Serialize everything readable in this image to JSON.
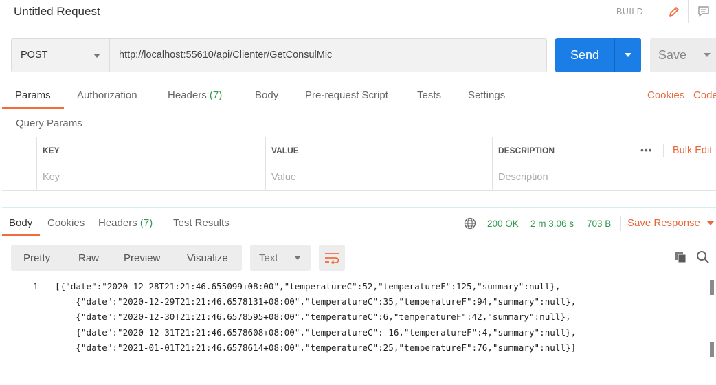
{
  "header": {
    "title": "Untitled Request",
    "build_label": "BUILD"
  },
  "request": {
    "method": "POST",
    "url": "http://localhost:55610/api/Clienter/GetConsulMic",
    "send_label": "Send",
    "save_label": "Save"
  },
  "req_tabs": {
    "params": "Params",
    "authorization": "Authorization",
    "headers": "Headers",
    "headers_count": "(7)",
    "body": "Body",
    "pre_request": "Pre-request Script",
    "tests": "Tests",
    "settings": "Settings",
    "cookies": "Cookies",
    "code": "Code"
  },
  "query_params": {
    "label": "Query Params",
    "columns": [
      "KEY",
      "VALUE",
      "DESCRIPTION"
    ],
    "placeholders": [
      "Key",
      "Value",
      "Description"
    ],
    "more": "•••",
    "bulk_edit": "Bulk Edit"
  },
  "resp_tabs": {
    "body": "Body",
    "cookies": "Cookies",
    "headers": "Headers",
    "headers_count": "(7)",
    "test_results": "Test Results"
  },
  "response_status": {
    "status": "200 OK",
    "time": "2 m 3.06 s",
    "size": "703 B",
    "save_response": "Save Response"
  },
  "view": {
    "pretty": "Pretty",
    "raw": "Raw",
    "preview": "Preview",
    "visualize": "Visualize",
    "format": "Text"
  },
  "body_code": {
    "line_number": "1",
    "lines": [
      "[{\"date\":\"2020-12-28T21:21:46.655099+08:00\",\"temperatureC\":52,\"temperatureF\":125,\"summary\":null},",
      "    {\"date\":\"2020-12-29T21:21:46.6578131+08:00\",\"temperatureC\":35,\"temperatureF\":94,\"summary\":null},",
      "    {\"date\":\"2020-12-30T21:21:46.6578595+08:00\",\"temperatureC\":6,\"temperatureF\":42,\"summary\":null},",
      "    {\"date\":\"2020-12-31T21:21:46.6578608+08:00\",\"temperatureC\":-16,\"temperatureF\":4,\"summary\":null},",
      "    {\"date\":\"2021-01-01T21:21:46.6578614+08:00\",\"temperatureC\":25,\"temperatureF\":76,\"summary\":null}]"
    ]
  },
  "colors": {
    "accent_orange": "#f26b3a",
    "send_blue": "#1b7ee6",
    "status_green": "#2e9a4e"
  }
}
